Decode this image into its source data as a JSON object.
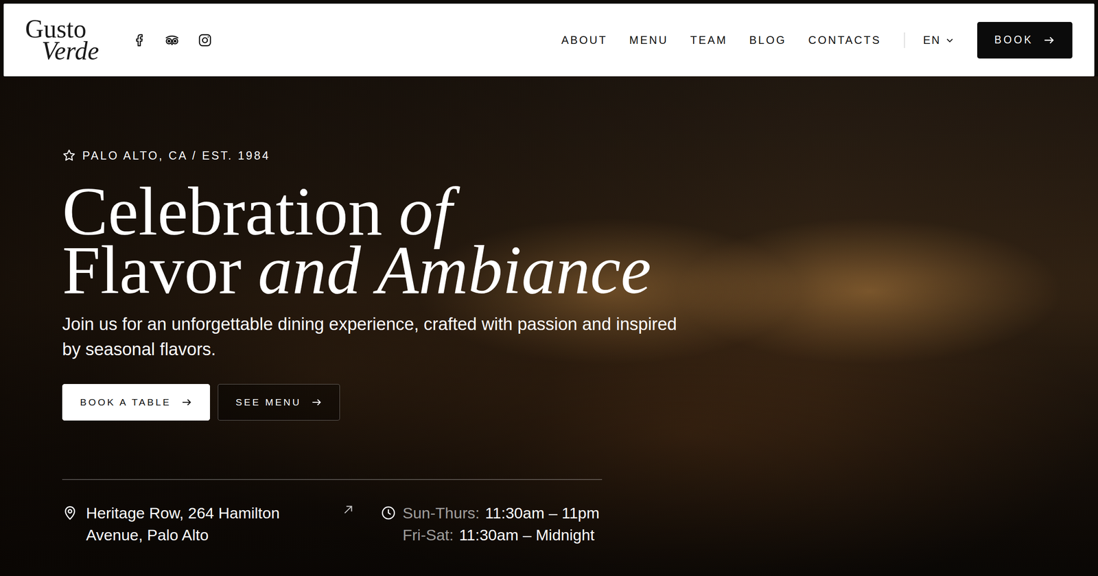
{
  "header": {
    "logo": [
      "Gusto",
      "Verde"
    ],
    "nav": [
      {
        "label": "ABOUT"
      },
      {
        "label": "MENU"
      },
      {
        "label": "TEAM"
      },
      {
        "label": "BLOG"
      },
      {
        "label": "CONTACTS"
      }
    ],
    "language": "EN",
    "book_button": "BOOK"
  },
  "hero": {
    "tagline": "PALO ALTO, CA / EST. 1984",
    "headline": [
      [
        {
          "text": "Celebration",
          "kind": "roman"
        },
        {
          "text": "of",
          "kind": "italic"
        }
      ],
      [
        {
          "text": "Flavor",
          "kind": "roman"
        },
        {
          "text": "and Ambiance",
          "kind": "italic"
        }
      ]
    ],
    "description": "Join us for an unforgettable dining experience, crafted with passion and inspired by seasonal flavors.",
    "buttons": [
      {
        "label": "BOOK A TABLE",
        "kind": "solid"
      },
      {
        "label": "SEE MENU",
        "kind": "outline"
      }
    ]
  },
  "info": {
    "address": [
      "Heritage Row, 264 Hamilton",
      "Avenue, Palo Alto"
    ],
    "hours": [
      {
        "days": "Sun-Thurs:",
        "time": "11:30am – 11pm"
      },
      {
        "days": "Fri-Sat:",
        "time": "11:30am – Midnight"
      }
    ]
  }
}
